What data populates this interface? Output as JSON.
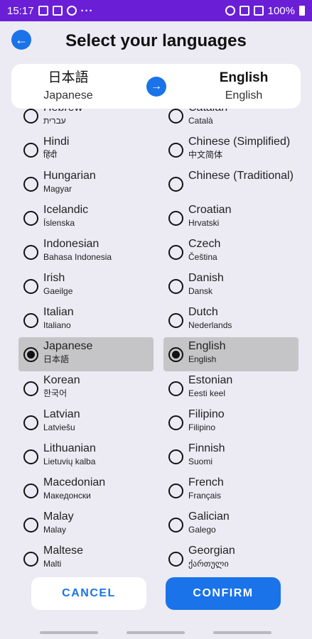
{
  "status_bar": {
    "time": "15:17",
    "more": "···",
    "battery": "100%"
  },
  "header": {
    "title": "Select your languages"
  },
  "source": {
    "native": "日本語",
    "name": "Japanese"
  },
  "target": {
    "native": "English",
    "name": "English"
  },
  "source_list": [
    {
      "name": "Hebrew",
      "native": "עברית",
      "selected": false
    },
    {
      "name": "Hindi",
      "native": "हिंदी",
      "selected": false
    },
    {
      "name": "Hungarian",
      "native": "Magyar",
      "selected": false
    },
    {
      "name": "Icelandic",
      "native": "Íslenska",
      "selected": false
    },
    {
      "name": "Indonesian",
      "native": "Bahasa Indonesia",
      "selected": false
    },
    {
      "name": "Irish",
      "native": "Gaeilge",
      "selected": false
    },
    {
      "name": "Italian",
      "native": "Italiano",
      "selected": false
    },
    {
      "name": "Japanese",
      "native": "日本語",
      "selected": true
    },
    {
      "name": "Korean",
      "native": "한국어",
      "selected": false
    },
    {
      "name": "Latvian",
      "native": "Latviešu",
      "selected": false
    },
    {
      "name": "Lithuanian",
      "native": "Lietuvių kalba",
      "selected": false
    },
    {
      "name": "Macedonian",
      "native": "Македонски",
      "selected": false
    },
    {
      "name": "Malay",
      "native": "Malay",
      "selected": false
    },
    {
      "name": "Maltese",
      "native": "Malti",
      "selected": false
    }
  ],
  "target_list": [
    {
      "name": "Catalan",
      "native": "Català",
      "selected": false
    },
    {
      "name": "Chinese (Simplified)",
      "native": "中文简体",
      "selected": false
    },
    {
      "name": "Chinese (Traditional)",
      "native": "",
      "selected": false
    },
    {
      "name": "Croatian",
      "native": "Hrvatski",
      "selected": false
    },
    {
      "name": "Czech",
      "native": "Čeština",
      "selected": false
    },
    {
      "name": "Danish",
      "native": "Dansk",
      "selected": false
    },
    {
      "name": "Dutch",
      "native": "Nederlands",
      "selected": false
    },
    {
      "name": "English",
      "native": "English",
      "selected": true
    },
    {
      "name": "Estonian",
      "native": "Eesti keel",
      "selected": false
    },
    {
      "name": "Filipino",
      "native": "Filipino",
      "selected": false
    },
    {
      "name": "Finnish",
      "native": "Suomi",
      "selected": false
    },
    {
      "name": "French",
      "native": "Français",
      "selected": false
    },
    {
      "name": "Galician",
      "native": "Galego",
      "selected": false
    },
    {
      "name": "Georgian",
      "native": "ქართული",
      "selected": false
    }
  ],
  "buttons": {
    "cancel": "CANCEL",
    "confirm": "CONFIRM"
  },
  "colors": {
    "accent": "#1A73E8",
    "status_bar": "#6A1FD6",
    "background": "#ECEAF3",
    "selected_row": "#C5C5C8"
  }
}
